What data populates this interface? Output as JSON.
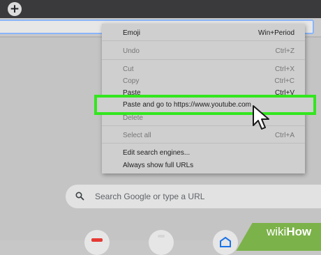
{
  "browser": {
    "new_tab_symbol": "+"
  },
  "context_menu": {
    "items": [
      {
        "label": "Emoji",
        "shortcut": "Win+Period",
        "enabled": true
      },
      {
        "label": "Undo",
        "shortcut": "Ctrl+Z",
        "enabled": false
      },
      {
        "label": "Cut",
        "shortcut": "Ctrl+X",
        "enabled": false
      },
      {
        "label": "Copy",
        "shortcut": "Ctrl+C",
        "enabled": false
      },
      {
        "label": "Paste",
        "shortcut": "Ctrl+V",
        "enabled": true
      },
      {
        "label": "Paste and go to https://www.youtube.com",
        "shortcut": "",
        "enabled": true,
        "highlighted": true
      },
      {
        "label": "Delete",
        "shortcut": "",
        "enabled": false
      },
      {
        "label": "Select all",
        "shortcut": "Ctrl+A",
        "enabled": false
      },
      {
        "label": "Edit search engines...",
        "shortcut": "",
        "enabled": true
      },
      {
        "label": "Always show full URLs",
        "shortcut": "",
        "enabled": true
      }
    ]
  },
  "search": {
    "placeholder": "Search Google or type a URL",
    "icon": "search-icon"
  },
  "shortcut_tiles": [
    {
      "icon": "youtube-icon"
    },
    {
      "icon": "shortcut-icon"
    },
    {
      "icon": "site-icon"
    }
  ],
  "watermark": {
    "part1": "wiki",
    "part2": "How"
  },
  "colors": {
    "highlight_border": "#33e61f",
    "watermark_bg": "#7cb24a"
  }
}
